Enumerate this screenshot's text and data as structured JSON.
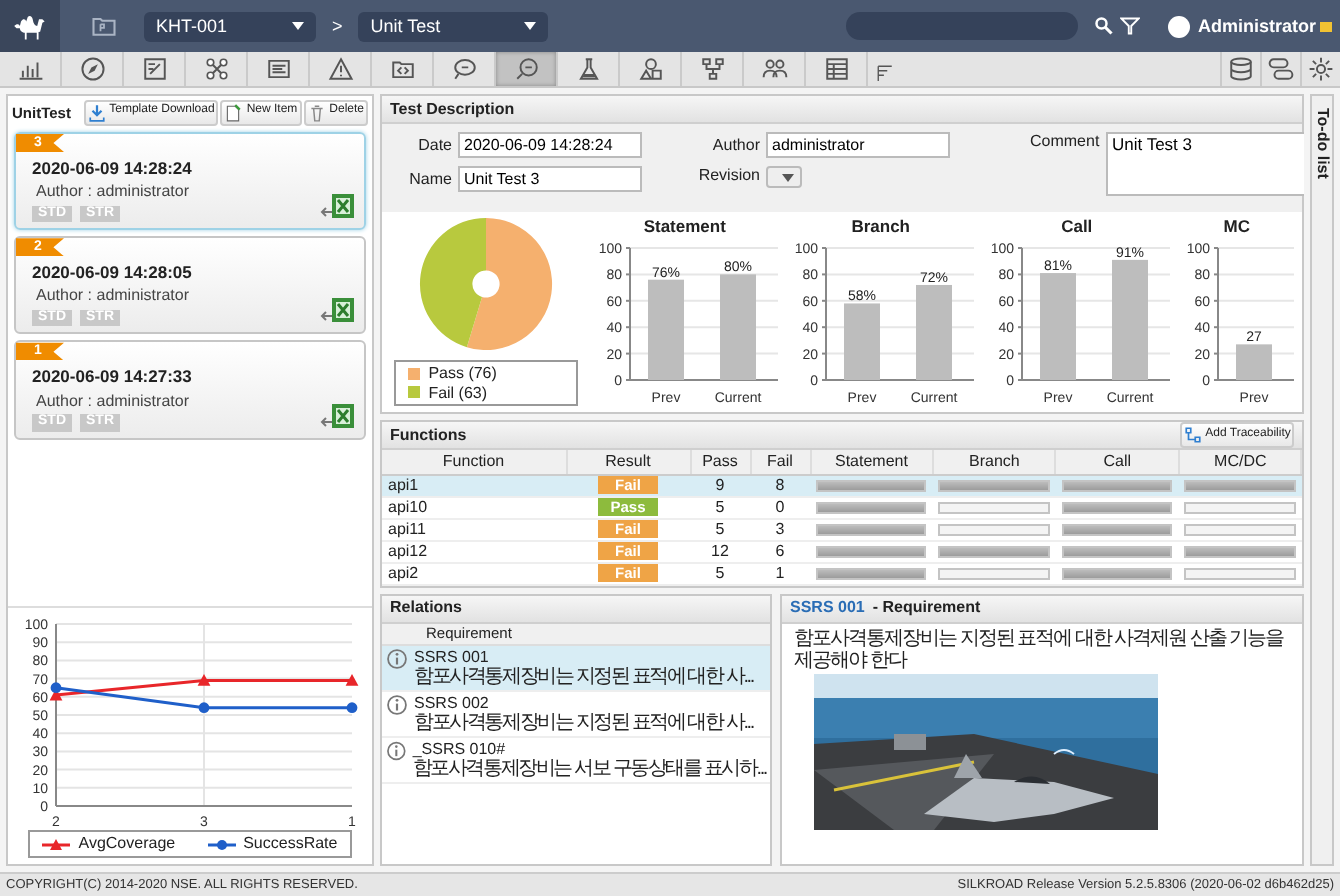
{
  "topbar": {
    "project": "KHT-001",
    "separator": ">",
    "view": "Unit Test",
    "user": "Administrator"
  },
  "toolbar": {
    "items": [
      {
        "selected": false
      },
      {
        "selected": false
      },
      {
        "selected": false
      },
      {
        "selected": false
      },
      {
        "selected": false
      },
      {
        "selected": false
      },
      {
        "selected": false
      },
      {
        "selected": false
      },
      {
        "selected": true
      },
      {
        "selected": false
      },
      {
        "selected": false
      },
      {
        "selected": false
      },
      {
        "selected": false
      },
      {
        "selected": false
      }
    ]
  },
  "unit_test": {
    "title": "UnitTest",
    "buttons": [
      "Template Download",
      "New Item",
      "Delete"
    ],
    "runs": [
      {
        "number": "3",
        "date": "2020-06-09 14:28:24",
        "author": "Author : administrator",
        "tags": [
          "STD",
          "STR"
        ],
        "selected": true
      },
      {
        "number": "2",
        "date": "2020-06-09 14:28:05",
        "author": "Author : administrator",
        "tags": [
          "STD",
          "STR"
        ],
        "selected": false
      },
      {
        "number": "1",
        "date": "2020-06-09 14:27:33",
        "author": "Author : administrator",
        "tags": [
          "STD",
          "STR"
        ],
        "selected": false
      }
    ],
    "trend": {
      "chart_data": {
        "type": "line",
        "categories": [
          "2",
          "3",
          "1"
        ],
        "series": [
          {
            "name": "AvgCoverage",
            "color": "#e8262a",
            "marker": "triangle",
            "values": [
              61,
              69,
              69
            ]
          },
          {
            "name": "SuccessRate",
            "color": "#1f5fc9",
            "marker": "circle",
            "values": [
              65,
              54,
              54
            ]
          }
        ],
        "ylim": [
          0,
          100
        ],
        "yticks": [
          0,
          10,
          20,
          30,
          40,
          50,
          60,
          70,
          80,
          90,
          100
        ],
        "grid": true,
        "legend": "bottom"
      }
    }
  },
  "test_description": {
    "title": "Test Description",
    "date": {
      "label": "Date",
      "value": "2020-06-09 14:28:24"
    },
    "author": {
      "label": "Author",
      "value": "administrator"
    },
    "comment": {
      "label": "Comment",
      "value": "Unit Test 3"
    },
    "name": {
      "label": "Name",
      "value": "Unit Test 3"
    },
    "revision": {
      "label": "Revision"
    },
    "summary": {
      "slices": [
        {
          "color": "#f5b06e"
        },
        {
          "color": "#b8c93e"
        }
      ],
      "chart_data": {
        "type": "donut",
        "categories": [
          "Pass (76)",
          "Fail (63)"
        ],
        "values": [
          76,
          63
        ],
        "legend": "bottom"
      }
    },
    "coverage": [
      {
        "chart_data": {
          "type": "bar",
          "title": "Statement",
          "categories": [
            "Prev",
            "Current"
          ],
          "values": [
            76,
            80
          ],
          "ylim": [
            0,
            100
          ],
          "yticks": [
            0,
            20,
            40,
            60,
            80,
            100
          ],
          "grid": true,
          "value_labels": [
            "76%",
            "80%"
          ]
        }
      },
      {
        "chart_data": {
          "type": "bar",
          "title": "Branch",
          "categories": [
            "Prev",
            "Current"
          ],
          "values": [
            58,
            72
          ],
          "ylim": [
            0,
            100
          ],
          "yticks": [
            0,
            20,
            40,
            60,
            80,
            100
          ],
          "grid": true,
          "value_labels": [
            "58%",
            "72%"
          ]
        }
      },
      {
        "chart_data": {
          "type": "bar",
          "title": "Call",
          "categories": [
            "Prev",
            "Current"
          ],
          "values": [
            81,
            91
          ],
          "ylim": [
            0,
            100
          ],
          "yticks": [
            0,
            20,
            40,
            60,
            80,
            100
          ],
          "grid": true,
          "value_labels": [
            "81%",
            "91%"
          ]
        }
      },
      {
        "chart_data": {
          "type": "bar",
          "title": "MC",
          "categories": [
            "Prev"
          ],
          "values": [
            27
          ],
          "ylim": [
            0,
            100
          ],
          "yticks": [
            0,
            20,
            40,
            60,
            80,
            100
          ],
          "grid": true,
          "value_labels": [
            "27"
          ]
        }
      }
    ]
  },
  "functions": {
    "title": "Functions",
    "button": "Add Traceability",
    "columns": [
      "Function",
      "Result",
      "Pass",
      "Fail",
      "Statement",
      "Branch",
      "Call",
      "MC/DC"
    ],
    "rows": [
      {
        "function": "api1",
        "result": "Fail",
        "passed": false,
        "pass": "9",
        "fail": "8",
        "coverage": [
          {
            "level": 1
          },
          {
            "level": 1
          },
          {
            "level": 1
          },
          {
            "level": 1
          }
        ],
        "selected": true
      },
      {
        "function": "api10",
        "result": "Pass",
        "passed": true,
        "pass": "5",
        "fail": "0",
        "coverage": [
          {
            "level": 1
          },
          {
            "level": 0
          },
          {
            "level": 1
          },
          {
            "level": 0
          }
        ],
        "selected": false
      },
      {
        "function": "api11",
        "result": "Fail",
        "passed": false,
        "pass": "5",
        "fail": "3",
        "coverage": [
          {
            "level": 1
          },
          {
            "level": 0
          },
          {
            "level": 1
          },
          {
            "level": 0
          }
        ],
        "selected": false
      },
      {
        "function": "api12",
        "result": "Fail",
        "passed": false,
        "pass": "12",
        "fail": "6",
        "coverage": [
          {
            "level": 1
          },
          {
            "level": 1
          },
          {
            "level": 1
          },
          {
            "level": 1
          }
        ],
        "selected": false
      },
      {
        "function": "api2",
        "result": "Fail",
        "passed": false,
        "pass": "5",
        "fail": "1",
        "coverage": [
          {
            "level": 1
          },
          {
            "level": 0
          },
          {
            "level": 1
          },
          {
            "level": 0
          }
        ],
        "selected": false
      }
    ]
  },
  "relations": {
    "title": "Relations",
    "column": "Requirement",
    "items": [
      {
        "id": "SSRS 001",
        "text": "함포사격통제장비는 지정된 표적에 대한 사...",
        "selected": true
      },
      {
        "id": "SSRS 002",
        "text": "함포사격통제장비는 지정된 표적에 대한 사...",
        "selected": false
      },
      {
        "id": "_SSRS 010#",
        "text": "함포사격통제장비는 서보 구동상태를 표시하...",
        "selected": false
      }
    ]
  },
  "requirement": {
    "id": "SSRS 001",
    "title": "- Requirement",
    "text": "함포사격통제장비는 지정된 표적에 대한 사격제원 산출 기능을 제공해야 한다"
  },
  "todo": {
    "title": "To-do list"
  },
  "footer": {
    "copyright": "COPYRIGHT(C) 2014-2020 NSE. ALL RIGHTS RESERVED.",
    "version": "SILKROAD Release Version 5.2.5.8306 (2020-06-02 d6b462d25)"
  }
}
